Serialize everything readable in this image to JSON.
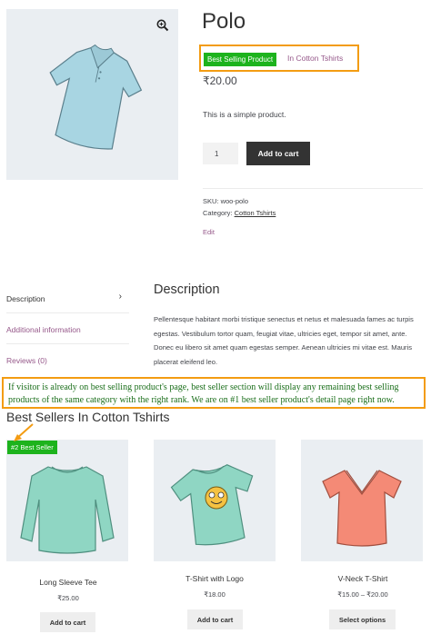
{
  "product": {
    "title": "Polo",
    "badge": "Best Selling Product",
    "badge_category": "In Cotton Tshirts",
    "price": "₹20.00",
    "short_description": "This is a simple product.",
    "quantity": "1",
    "add_to_cart_label": "Add to cart",
    "sku": "SKU: woo-polo",
    "category_label": "Category:",
    "category_name": "Cotton Tshirts",
    "edit_label": "Edit"
  },
  "tabs": [
    {
      "label": "Description"
    },
    {
      "label": "Additional information"
    },
    {
      "label": "Reviews (0)"
    }
  ],
  "description": {
    "heading": "Description",
    "text": "Pellentesque habitant morbi tristique senectus et netus et malesuada fames ac turpis egestas. Vestibulum tortor quam, feugiat vitae, ultricies eget, tempor sit amet, ante. Donec eu libero sit amet quam egestas semper. Aenean ultricies mi vitae est. Mauris placerat eleifend leo."
  },
  "note": "If visitor is already on best selling product's page, best seller section will display any remaining best selling products of the same category with the right rank. We are on #1 best seller product's detail page right now.",
  "best_sellers": {
    "heading": "Best Sellers In Cotton Tshirts",
    "rank_badge": "#2 Best Seller",
    "items": [
      {
        "title": "Long Sleeve Tee",
        "price": "₹25.00",
        "button": "Add to cart"
      },
      {
        "title": "T-Shirt with Logo",
        "price": "₹18.00",
        "button": "Add to cart"
      },
      {
        "title": "V-Neck T-Shirt",
        "price": "₹15.00 – ₹20.00",
        "button": "Select options"
      }
    ]
  },
  "icons": {
    "zoom": "zoom-icon",
    "chevron": "chevron-right-icon"
  },
  "colors": {
    "badge_green": "#1db31d",
    "accent_purple": "#96588a",
    "highlight_orange": "#f39c12",
    "button_dark": "#333333"
  }
}
